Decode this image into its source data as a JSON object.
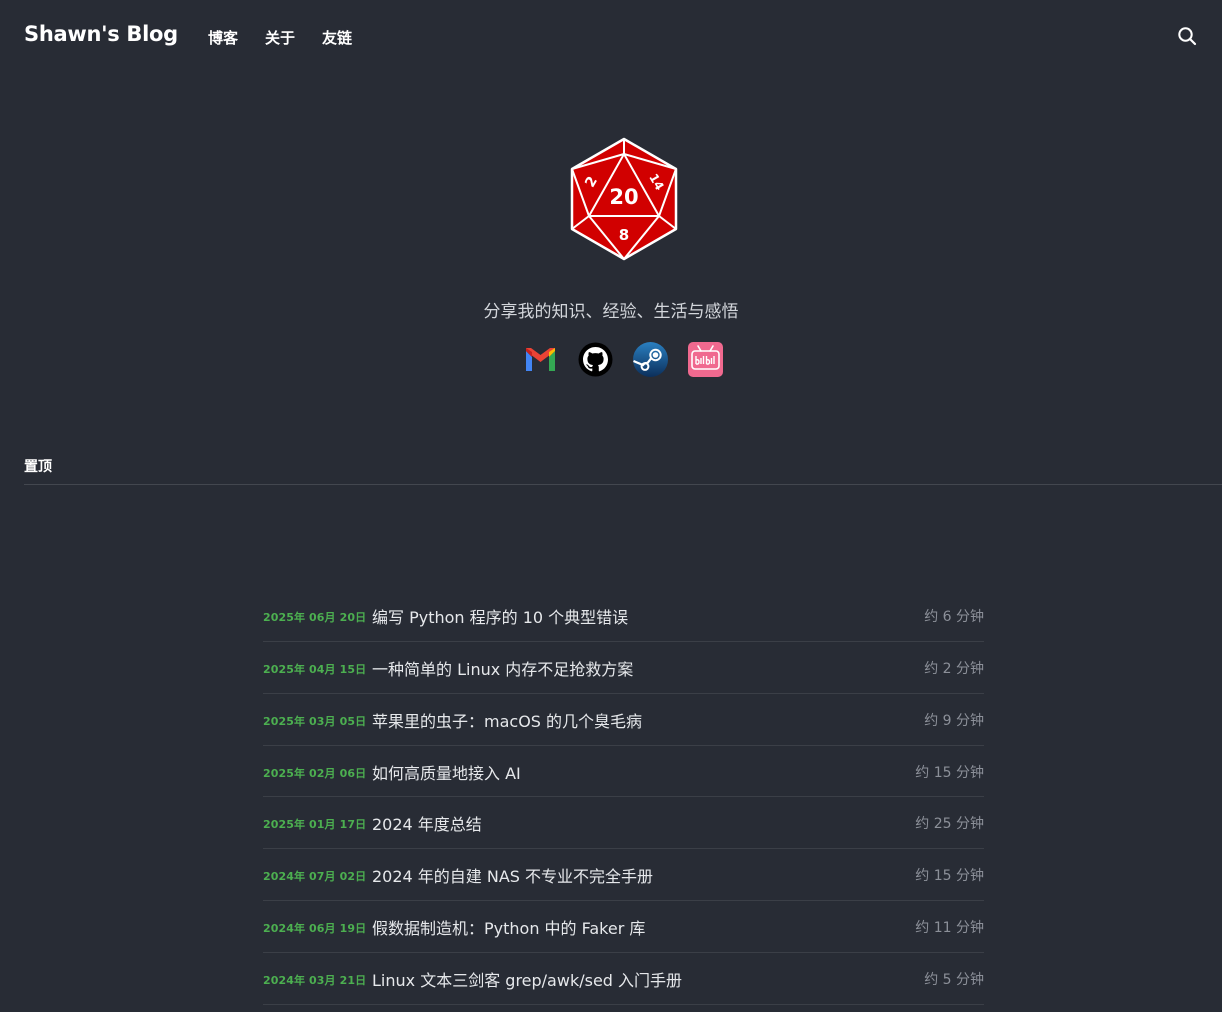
{
  "site": {
    "title": "Shawn's Blog",
    "tagline": "分享我的知识、经验、生活与感悟"
  },
  "nav": {
    "items": [
      {
        "label": "博客"
      },
      {
        "label": "关于"
      },
      {
        "label": "友链"
      }
    ],
    "search_icon": "search-icon"
  },
  "hero": {
    "logo_icon": "d20-dice-icon",
    "logo_numbers": [
      "20",
      "2",
      "14",
      "8"
    ],
    "colors": {
      "dice_red": "#d10000",
      "dice_edge": "#ffffff"
    }
  },
  "social": [
    {
      "icon": "gmail-icon"
    },
    {
      "icon": "github-icon"
    },
    {
      "icon": "steam-icon"
    },
    {
      "icon": "bilibili-icon"
    }
  ],
  "pinned": {
    "heading": "置顶"
  },
  "colors": {
    "background": "#282c35",
    "date_accent": "#4caf50",
    "text": "#e6e8eb",
    "muted": "#8c9099"
  },
  "posts": [
    {
      "date": "2025年 06月 20日",
      "title": "编写 Python 程序的 10 个典型错误",
      "read_time": "约 6 分钟"
    },
    {
      "date": "2025年 04月 15日",
      "title": "一种简单的 Linux 内存不足抢救方案",
      "read_time": "约 2 分钟"
    },
    {
      "date": "2025年 03月 05日",
      "title": "苹果里的虫子：macOS 的几个臭毛病",
      "read_time": "约 9 分钟"
    },
    {
      "date": "2025年 02月 06日",
      "title": "如何高质量地接入 AI",
      "read_time": "约 15 分钟"
    },
    {
      "date": "2025年 01月 17日",
      "title": "2024 年度总结",
      "read_time": "约 25 分钟"
    },
    {
      "date": "2024年 07月 02日",
      "title": "2024 年的自建 NAS 不专业不完全手册",
      "read_time": "约 15 分钟"
    },
    {
      "date": "2024年 06月 19日",
      "title": "假数据制造机：Python 中的 Faker 库",
      "read_time": "约 11 分钟"
    },
    {
      "date": "2024年 03月 21日",
      "title": "Linux 文本三剑客 grep/awk/sed 入门手册",
      "read_time": "约 5 分钟"
    }
  ]
}
